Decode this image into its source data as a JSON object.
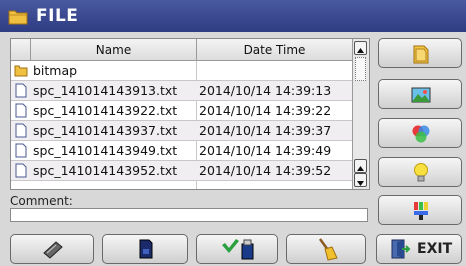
{
  "window": {
    "title": "FILE"
  },
  "file_list": {
    "columns": [
      "Name",
      "Date Time"
    ],
    "rows": [
      {
        "name": "bitmap",
        "date": "",
        "type": "folder"
      },
      {
        "name": "spc_141014143913.txt",
        "date": "2014/10/14 14:39:13",
        "type": "file"
      },
      {
        "name": "spc_141014143922.txt",
        "date": "2014/10/14 14:39:22",
        "type": "file"
      },
      {
        "name": "spc_141014143937.txt",
        "date": "2014/10/14 14:39:37",
        "type": "file"
      },
      {
        "name": "spc_141014143949.txt",
        "date": "2014/10/14 14:39:49",
        "type": "file"
      },
      {
        "name": "spc_141014143952.txt",
        "date": "2014/10/14 14:39:52",
        "type": "file"
      }
    ]
  },
  "comment": {
    "label": "Comment:",
    "value": ""
  },
  "side_buttons": [
    "folder-icon",
    "image-icon",
    "color-circles-icon",
    "lightbulb-icon",
    "color-bars-icon"
  ],
  "bottom_buttons": [
    "memory-chip-icon",
    "sd-card-icon",
    "usb-check-icon",
    "broom-icon"
  ],
  "exit": {
    "label": "EXIT"
  },
  "colors": {
    "titlebar": "#2e3c82",
    "folder": "#e8b030"
  }
}
